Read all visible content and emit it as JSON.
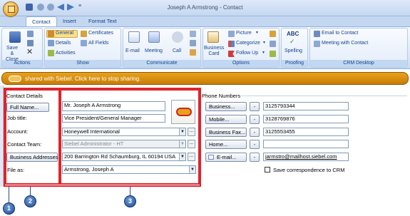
{
  "window": {
    "title": "Joseph A Armstrong - Contact",
    "qat_sep": "≡"
  },
  "tabs": [
    {
      "label": "Contact"
    },
    {
      "label": "Insert"
    },
    {
      "label": "Format Text"
    }
  ],
  "ribbon": {
    "actions": {
      "label": "Actions",
      "save_close": "Save & Close"
    },
    "show": {
      "label": "Show",
      "general": "General",
      "details": "Details",
      "activities": "Activities",
      "certificates": "Certificates",
      "all_fields": "All Fields"
    },
    "communicate": {
      "label": "Communicate",
      "email": "E-mail",
      "meeting": "Meeting",
      "call": "Call"
    },
    "options": {
      "label": "Options",
      "business_card": "Business Card",
      "picture": "Picture",
      "categorize": "Categorize",
      "follow_up": "Follow Up"
    },
    "proofing": {
      "label": "Proofing",
      "spelling": "Spelling",
      "abc": "ABC"
    },
    "crm": {
      "label": "CRM Desktop",
      "email_to_contact": "Email to Contact",
      "meeting_with_contact": "Meeting with Contact"
    }
  },
  "infobar": {
    "text": "shared with Siebel. Click here to stop sharing."
  },
  "contact": {
    "section_label": "Contact Details",
    "full_name_button": "Full Name...",
    "full_name_value": "Mr. Joseph A Armstrong",
    "job_title_label": "Job title:",
    "job_title_value": "Vice President/General  Manager",
    "account_label": "Account:",
    "account_value": "Honeywell International",
    "contact_team_label": "Contact Team:",
    "contact_team_value": "Siebel Administrator - HT",
    "business_addresses_button": "Business Addresses",
    "business_address_value": "200 Barrington Rd Schaumburg, IL 60194 USA",
    "file_as_label": "File as:",
    "file_as_value": "Armstrong, Joseph A",
    "ellipsis": "..."
  },
  "phones": {
    "section_label": "Phone Numbers",
    "dash": "-",
    "rows": [
      {
        "button": "Business...",
        "value": "3125793344"
      },
      {
        "button": "Mobile...",
        "value": "3128769876"
      },
      {
        "button": "Business Fax...",
        "value": "3125553455"
      },
      {
        "button": "Home...",
        "value": ""
      },
      {
        "button": "E-mail...",
        "value": "jarmstro@mailhost.siebel.com"
      }
    ],
    "save_correspondence": "Save correspondence to CRM"
  },
  "callouts": [
    "1",
    "2",
    "3"
  ],
  "colors": {
    "accent": "#15428b",
    "callout": "#1f4e9a",
    "highlight": "#e0232c",
    "infobar": "#e09414"
  }
}
